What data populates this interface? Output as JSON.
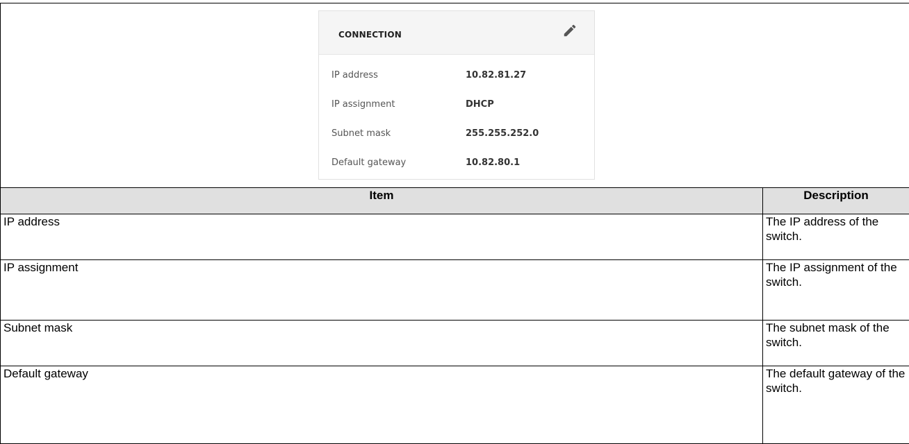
{
  "connection_card": {
    "title": "CONNECTION",
    "edit_icon": "pencil-icon",
    "rows": [
      {
        "label": "IP address",
        "value": "10.82.81.27"
      },
      {
        "label": "IP assignment",
        "value": "DHCP"
      },
      {
        "label": "Subnet mask",
        "value": "255.255.252.0"
      },
      {
        "label": "Default gateway",
        "value": "10.82.80.1"
      }
    ]
  },
  "table": {
    "headers": [
      "Item",
      "Description"
    ],
    "rows": [
      {
        "item": "IP address",
        "description": "The IP address of the switch."
      },
      {
        "item": "IP assignment",
        "description": "The IP assignment of the switch."
      },
      {
        "item": "Subnet mask",
        "description": "The subnet mask of the switch."
      },
      {
        "item": "Default gateway",
        "description": "The default gateway of the switch."
      }
    ]
  },
  "colors": {
    "header_bg": "#e0e0e0",
    "card_header_bg": "#f5f5f5",
    "border": "#000000"
  }
}
